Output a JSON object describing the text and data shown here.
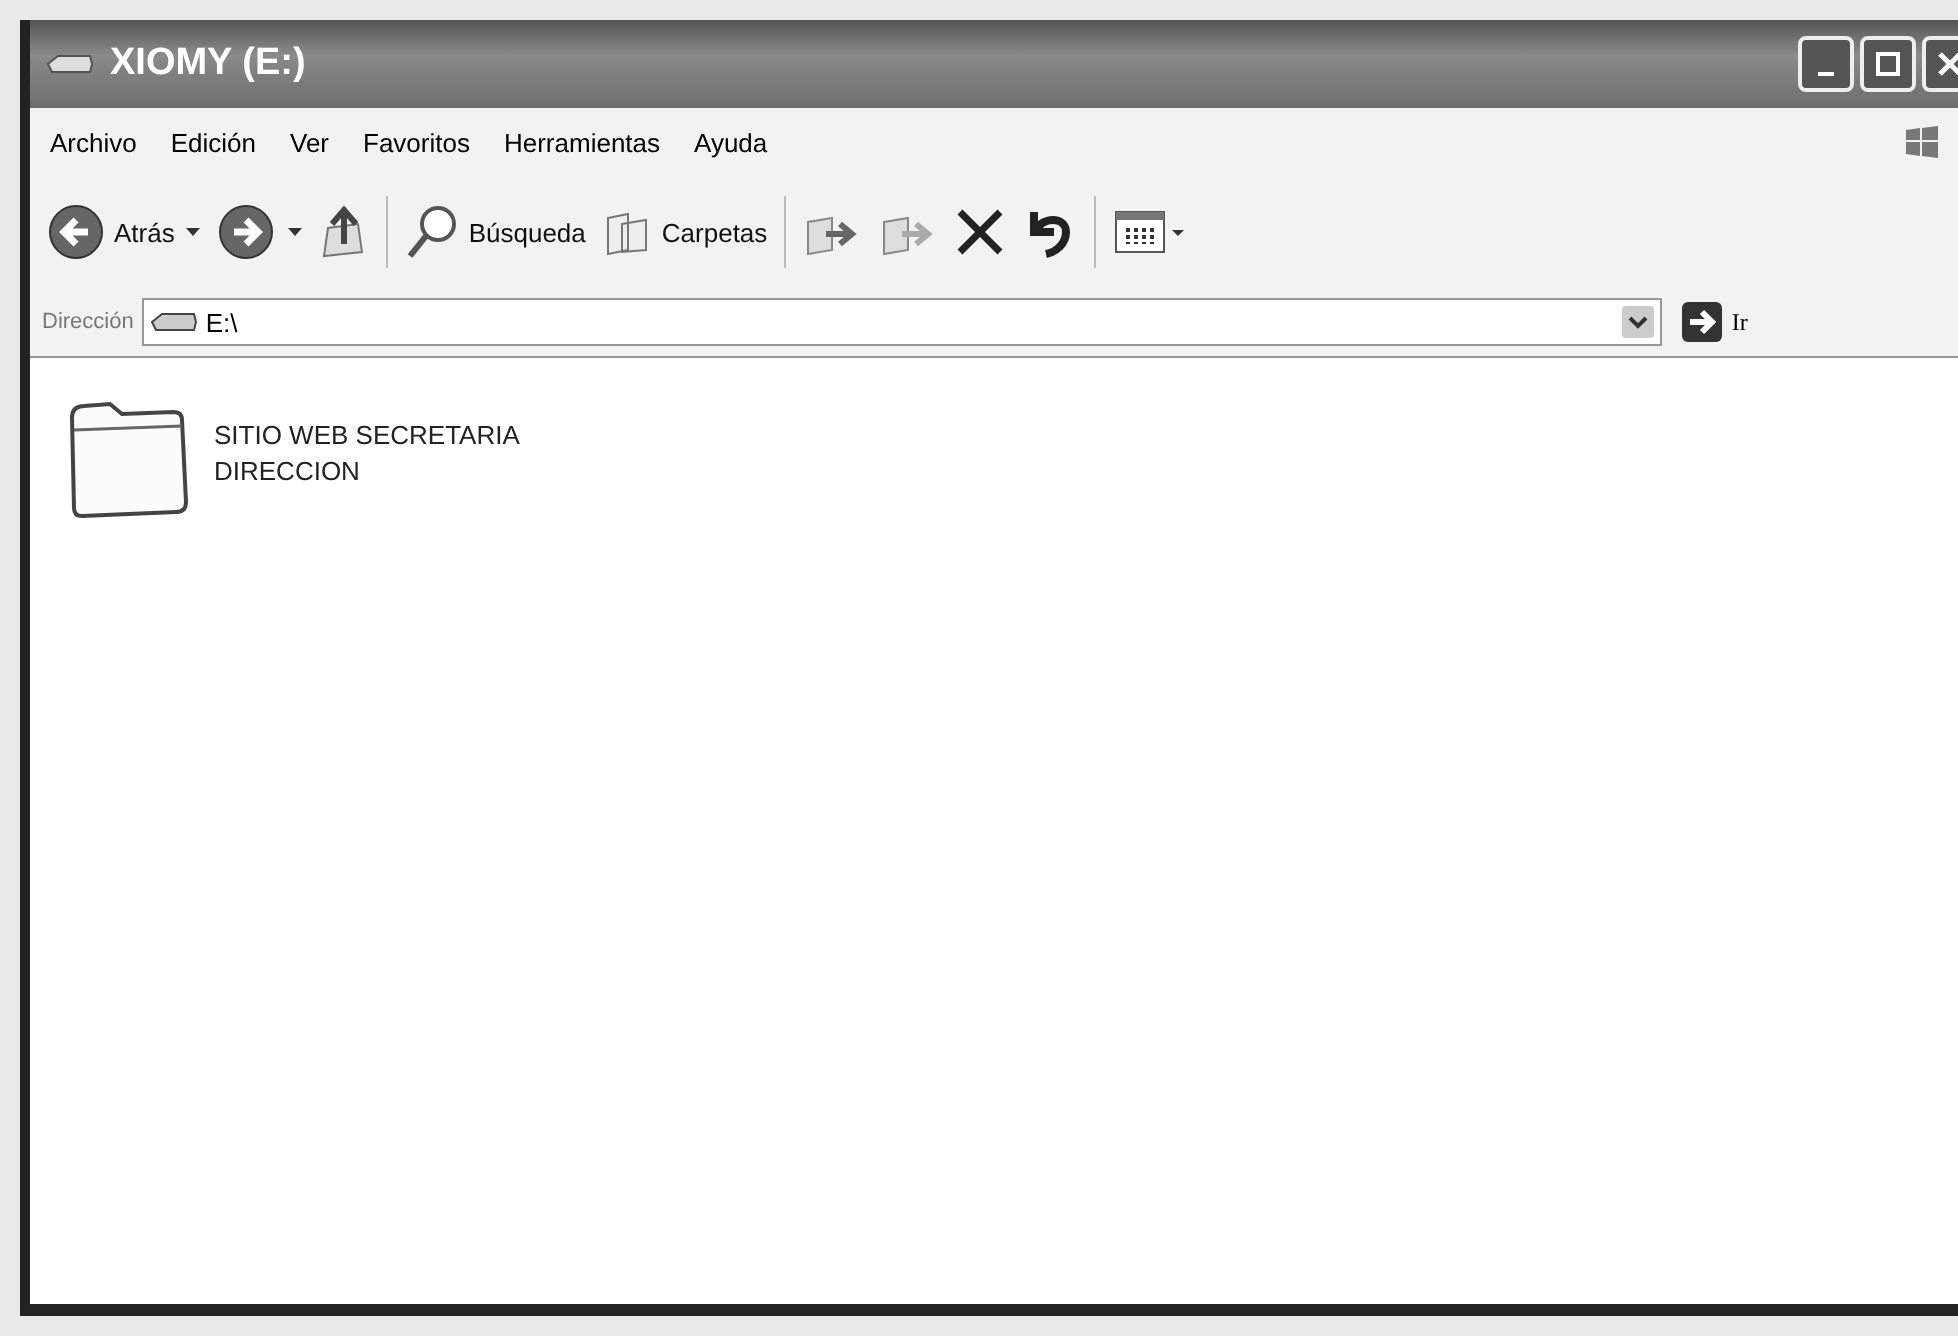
{
  "window": {
    "title": "XIOMY (E:)"
  },
  "menu": [
    "Archivo",
    "Edición",
    "Ver",
    "Favoritos",
    "Herramientas",
    "Ayuda"
  ],
  "toolbar": [
    {
      "kind": "back",
      "label": "Atrás"
    },
    {
      "kind": "forward"
    },
    {
      "kind": "up"
    },
    {
      "kind": "search",
      "label": "Búsqueda"
    },
    {
      "kind": "folders",
      "label": "Carpetas"
    },
    {
      "kind": "move"
    },
    {
      "kind": "copy"
    },
    {
      "kind": "delete"
    },
    {
      "kind": "undo"
    },
    {
      "kind": "views"
    }
  ],
  "address": {
    "label": "Dirección",
    "value": "E:\\",
    "go": "Ir"
  },
  "items": [
    {
      "name": "SITIO WEB SECRETARIA DIRECCION"
    }
  ]
}
